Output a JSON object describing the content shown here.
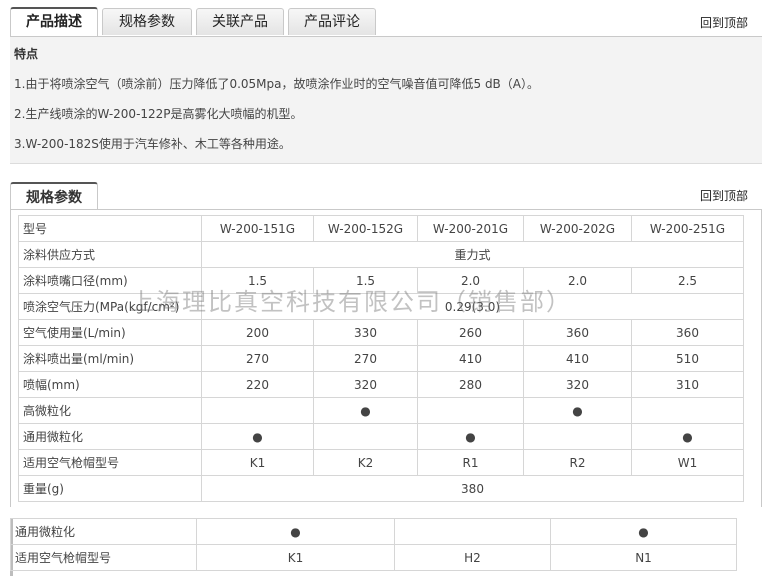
{
  "tabs": [
    "产品描述",
    "规格参数",
    "关联产品",
    "产品评论"
  ],
  "back_to_top": "回到顶部",
  "description": {
    "heading": "特点",
    "lines": [
      "1.由于将喷涂空气（喷涂前）压力降低了0.05Mpa，故喷涂作业时的空气噪音值可降低5 dB（A）。",
      "2.生产线喷涂的W-200-122P是高雾化大喷幅的机型。",
      "3.W-200-182S使用于汽车修补、木工等各种用途。"
    ]
  },
  "spec_section": {
    "title": "规格参数",
    "back_to_top": "回到顶部"
  },
  "spec_table": {
    "header_label": "型号",
    "models": [
      "W-200-151G",
      "W-200-152G",
      "W-200-201G",
      "W-200-202G",
      "W-200-251G"
    ],
    "rows": [
      {
        "label": "涂料供应方式",
        "span": "重力式"
      },
      {
        "label": "涂料喷嘴口径(mm)",
        "values": [
          "1.5",
          "1.5",
          "2.0",
          "2.0",
          "2.5"
        ]
      },
      {
        "label": "喷涂空气压力(MPa(kgf/cm²)",
        "span": "0.29(3.0)"
      },
      {
        "label": "空气使用量(L/min)",
        "values": [
          "200",
          "330",
          "260",
          "360",
          "360"
        ]
      },
      {
        "label": "涂料喷出量(ml/min)",
        "values": [
          "270",
          "270",
          "410",
          "410",
          "510"
        ]
      },
      {
        "label": "喷幅(mm)",
        "values": [
          "220",
          "320",
          "280",
          "320",
          "310"
        ]
      },
      {
        "label": "高微粒化",
        "values": [
          "",
          "●",
          "",
          "●",
          ""
        ]
      },
      {
        "label": "通用微粒化",
        "values": [
          "●",
          "",
          "●",
          "",
          "●"
        ]
      },
      {
        "label": "适用空气枪帽型号",
        "values": [
          "K1",
          "K2",
          "R1",
          "R2",
          "W1"
        ]
      },
      {
        "label": "重量(g)",
        "span": "380"
      }
    ]
  },
  "spec_table2": {
    "rows": [
      {
        "label": "通用微粒化",
        "values": [
          "●",
          "",
          "●"
        ]
      },
      {
        "label": "适用空气枪帽型号",
        "values": [
          "K1",
          "H2",
          "N1"
        ]
      }
    ]
  },
  "watermark": "上海理比真空科技有限公司（销售部）"
}
